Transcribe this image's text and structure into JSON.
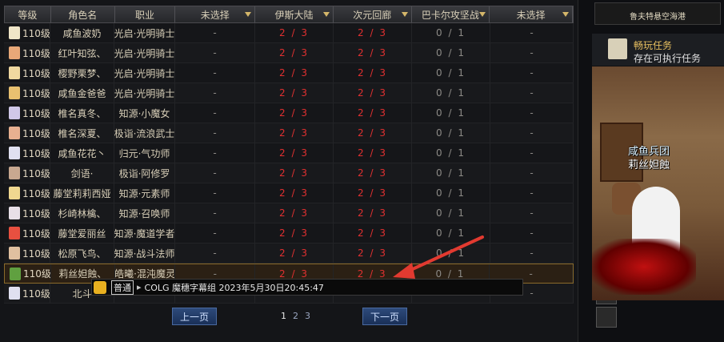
{
  "table": {
    "headers": [
      {
        "label": "等级",
        "dropdown": false
      },
      {
        "label": "角色名",
        "dropdown": false
      },
      {
        "label": "职业",
        "dropdown": false
      },
      {
        "label": "未选择",
        "dropdown": true
      },
      {
        "label": "伊斯大陆",
        "dropdown": true
      },
      {
        "label": "次元回廊",
        "dropdown": true
      },
      {
        "label": "巴卡尔攻坚战",
        "dropdown": true
      },
      {
        "label": "未选择",
        "dropdown": true
      }
    ],
    "rows": [
      {
        "level": "110级",
        "name": "咸鱼波奶",
        "job": "光启·光明骑士",
        "c1": "-",
        "c2": "2 / 3",
        "c3": "2 / 3",
        "c4": "0 / 1",
        "c5": "-",
        "avatar_color": "#f0e6c8"
      },
      {
        "level": "110级",
        "name": "红叶知弦、",
        "job": "光启·光明骑士",
        "c1": "-",
        "c2": "2 / 3",
        "c3": "2 / 3",
        "c4": "0 / 1",
        "c5": "-",
        "avatar_color": "#e8a878"
      },
      {
        "level": "110级",
        "name": "樱野栗梦、",
        "job": "光启·光明骑士",
        "c1": "-",
        "c2": "2 / 3",
        "c3": "2 / 3",
        "c4": "0 / 1",
        "c5": "-",
        "avatar_color": "#f0d8a0"
      },
      {
        "level": "110级",
        "name": "咸鱼金爸爸",
        "job": "光启·光明骑士",
        "c1": "-",
        "c2": "2 / 3",
        "c3": "2 / 3",
        "c4": "0 / 1",
        "c5": "-",
        "avatar_color": "#e8c070"
      },
      {
        "level": "110级",
        "name": "椎名真冬、",
        "job": "知源·小魔女",
        "c1": "-",
        "c2": "2 / 3",
        "c3": "2 / 3",
        "c4": "0 / 1",
        "c5": "-",
        "avatar_color": "#d0c8e8"
      },
      {
        "level": "110级",
        "name": "椎名深夏、",
        "job": "极诣·流浪武士",
        "c1": "-",
        "c2": "2 / 3",
        "c3": "2 / 3",
        "c4": "0 / 1",
        "c5": "-",
        "avatar_color": "#e8b090"
      },
      {
        "level": "110级",
        "name": "咸鱼花花丶",
        "job": "归元·气功师",
        "c1": "-",
        "c2": "2 / 3",
        "c3": "2 / 3",
        "c4": "0 / 1",
        "c5": "-",
        "avatar_color": "#e0e0f0"
      },
      {
        "level": "110级",
        "name": "剑语·",
        "job": "极诣·阿修罗",
        "c1": "-",
        "c2": "2 / 3",
        "c3": "2 / 3",
        "c4": "0 / 1",
        "c5": "-",
        "avatar_color": "#c8a890"
      },
      {
        "level": "110级",
        "name": "藤堂莉莉西娅",
        "job": "知源·元素师",
        "c1": "-",
        "c2": "2 / 3",
        "c3": "2 / 3",
        "c4": "0 / 1",
        "c5": "-",
        "avatar_color": "#f0d890"
      },
      {
        "level": "110级",
        "name": "杉崎林檎、",
        "job": "知源·召唤师",
        "c1": "-",
        "c2": "2 / 3",
        "c3": "2 / 3",
        "c4": "0 / 1",
        "c5": "-",
        "avatar_color": "#e8e0e8"
      },
      {
        "level": "110级",
        "name": "藤堂爱丽丝",
        "job": "知源·魔道学者",
        "c1": "-",
        "c2": "2 / 3",
        "c3": "2 / 3",
        "c4": "0 / 1",
        "c5": "-",
        "avatar_color": "#e85040"
      },
      {
        "level": "110级",
        "name": "松原飞鸟、",
        "job": "知源·战斗法师",
        "c1": "-",
        "c2": "2 / 3",
        "c3": "2 / 3",
        "c4": "0 / 1",
        "c5": "-",
        "avatar_color": "#e0c0a0"
      },
      {
        "level": "110级",
        "name": "莉丝妲蝕、",
        "job": "皓曦·混沌魔灵",
        "c1": "-",
        "c2": "2 / 3",
        "c3": "2 / 3",
        "c4": "0 / 1",
        "c5": "-",
        "avatar_color": "#60a040"
      },
      {
        "level": "110级",
        "name": "北斗",
        "job": "",
        "c1": "-",
        "c2": "",
        "c3": "",
        "c4": "",
        "c5": "-",
        "avatar_color": "#e0e0f0"
      }
    ]
  },
  "pager": {
    "prev": "上一页",
    "next": "下一页",
    "pages": [
      "1",
      "2",
      "3"
    ]
  },
  "chat": {
    "channel": "普通",
    "message": "COLG 魔穗字幕组 2023年5月30日20:45:47"
  },
  "sidebar": {
    "location": "鲁夫特悬空海港",
    "quest_title": "畅玩任务",
    "quest_desc": "存在可执行任务",
    "scene_label_1": "咸鱼兵团",
    "scene_label_2": "莉丝妲蝕"
  },
  "colors": {
    "accent": "#d4b66a",
    "red": "#e03030",
    "blue": "#2d4a7a"
  }
}
